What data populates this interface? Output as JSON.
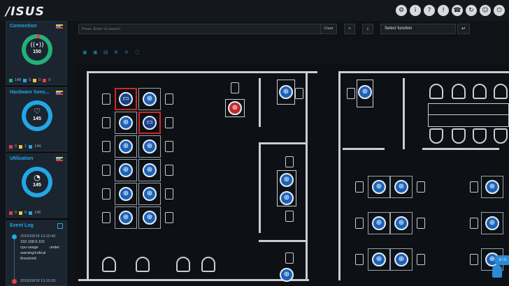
{
  "header": {
    "logo": "/ISUS",
    "icons": [
      "settings-icon",
      "info-icon",
      "help-icon",
      "alarm-icon",
      "support-icon",
      "refresh-icon",
      "user-icon",
      "logout-icon"
    ]
  },
  "sidebar": {
    "connection": {
      "title": "Connection",
      "value": "150",
      "glyph": "((•))",
      "legend": [
        "148",
        "0",
        "0",
        "0"
      ]
    },
    "hardware": {
      "title": "Hardware Sens...",
      "value": "145",
      "glyph": "♡",
      "legend": [
        "0",
        "1",
        "144"
      ]
    },
    "utilization": {
      "title": "Utilization",
      "value": "145",
      "glyph": "◔",
      "legend": [
        "0",
        "0",
        "145"
      ]
    },
    "event_log": {
      "title": "Event Log",
      "entries": [
        {
          "time": "2019/09/18 13:10:40",
          "host": "192.168.0.101",
          "text1": "cpu-usage",
          "text2": "under",
          "text3": "warning/critical",
          "text4": "threshold"
        },
        {
          "time": "2019/09/18 13:10:20"
        }
      ]
    }
  },
  "toolbar": {
    "search_placeholder": "Press 'Enter' to search",
    "clear_label": "Clear",
    "select_value": "Select function",
    "go_symbol": "↵"
  },
  "map": {
    "badge": "0 / 0"
  },
  "colors": {
    "accent": "#22a7e6",
    "alarm": "#d12828",
    "ok": "#23b07a",
    "device": "#1c63b8"
  }
}
